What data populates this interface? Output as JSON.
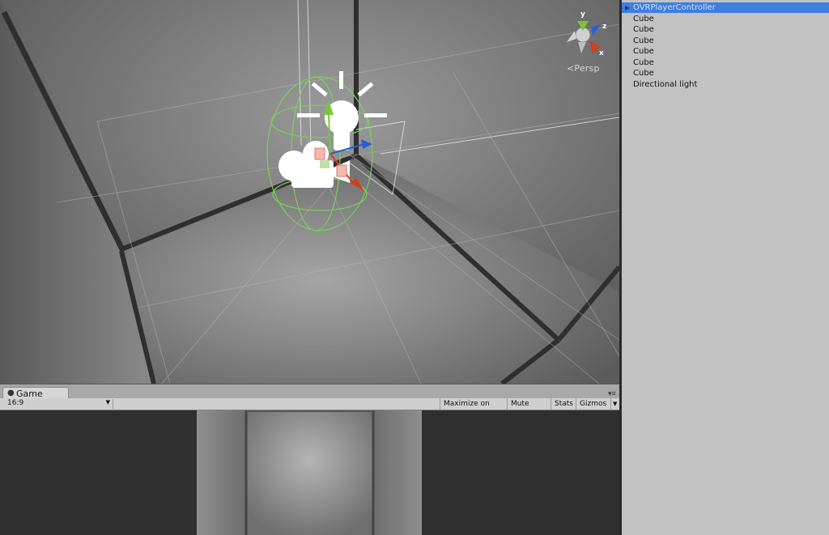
{
  "scene": {
    "view_mode": "Persp",
    "gizmo_axes": {
      "y": "y",
      "z": "z",
      "x": "x"
    },
    "icons": [
      "light-bulb-icon",
      "camera-icon"
    ]
  },
  "hierarchy": {
    "items": [
      {
        "label": "OVRPlayerController",
        "selected": true,
        "expandable": true
      },
      {
        "label": "Cube"
      },
      {
        "label": "Cube"
      },
      {
        "label": "Cube"
      },
      {
        "label": "Cube"
      },
      {
        "label": "Cube"
      },
      {
        "label": "Cube"
      },
      {
        "label": "Directional light"
      }
    ]
  },
  "game": {
    "tab_label": "Game",
    "aspect": "16:9",
    "buttons": {
      "maximize": "Maximize on Play",
      "mute": "Mute audio",
      "stats": "Stats",
      "gizmos": "Gizmos"
    }
  },
  "colors": {
    "selection": "#3e7ee0",
    "panel": "#c2c2c2",
    "axis_x": "#d04020",
    "axis_y": "#7ac43a",
    "axis_z": "#2b5fd6"
  }
}
